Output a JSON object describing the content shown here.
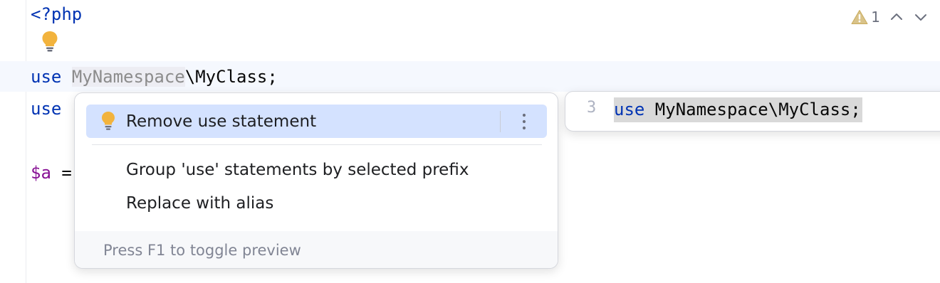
{
  "editor": {
    "lines": {
      "php_open": "<?php",
      "use1_kw": "use",
      "use1_ns": "MyNamespace",
      "use1_rest": "\\MyClass;",
      "use2_kw": "use",
      "var_a": "$a",
      "var_eq": " ="
    }
  },
  "inspection_widget": {
    "warning_count": "1"
  },
  "intention_popup": {
    "items": [
      {
        "label": "Remove use statement",
        "selected": true
      },
      {
        "label": "Group 'use' statements by selected prefix"
      },
      {
        "label": "Replace with alias"
      }
    ],
    "footer": "Press F1 to toggle preview"
  },
  "preview": {
    "line_number": "3",
    "code_kw": "use",
    "code_rest": " MyNamespace\\MyClass;"
  },
  "colors": {
    "keyword": "#0033b3",
    "selected_item_bg": "#d4e2ff",
    "bulb": "#f2b33d"
  }
}
